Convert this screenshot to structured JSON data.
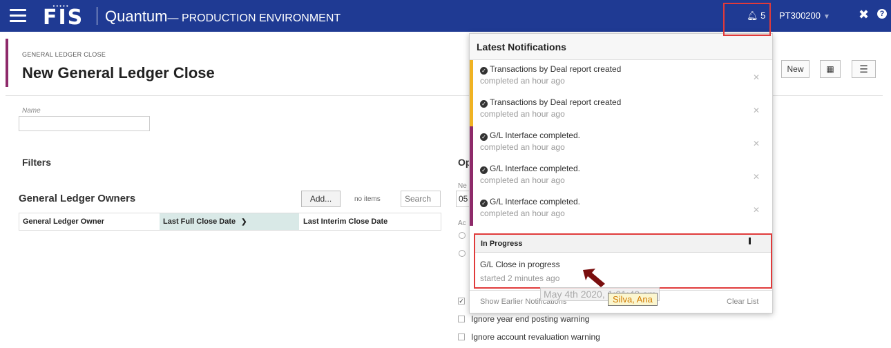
{
  "topbar": {
    "logo": "FIS",
    "app_name": "Quantum",
    "env": "— PRODUCTION ENVIRONMENT",
    "notification_count": "5",
    "user": "PT300200",
    "bell_icon": "bell-icon",
    "tools_icon": "tools-icon",
    "help_icon": "help-icon",
    "bar_color": "#1f3a93"
  },
  "header": {
    "breadcrumb": "GENERAL LEDGER CLOSE",
    "title": "New General Ledger Close",
    "new_label": "New"
  },
  "form": {
    "name_label": "Name",
    "name_value": "",
    "filters_title": "Filters",
    "owners_title": "General Ledger Owners",
    "add_label": "Add...",
    "no_items": "no items",
    "search_placeholder": "Search",
    "columns": [
      "General Ledger Owner",
      "Last Full Close Date",
      "Last Interim Close Date"
    ]
  },
  "options": {
    "title": "Op",
    "small_label_1": "Ne",
    "input_value": "05",
    "small_label_2": "Ac",
    "checkbox_1": "Ignore year end posting warning",
    "checkbox_2": "Ignore account revaluation warning"
  },
  "notifications": {
    "title": "Latest Notifications",
    "items": [
      {
        "text": "Transactions by Deal report created",
        "time": "completed an hour ago",
        "color": "#f0b323"
      },
      {
        "text": "Transactions by Deal report created",
        "time": "completed an hour ago",
        "color": "#f0b323"
      },
      {
        "text": "G/L Interface completed.",
        "time": "completed an hour ago",
        "color": "#8e2a6a"
      },
      {
        "text": "G/L Interface completed.",
        "time": "completed an hour ago",
        "color": "#8e2a6a"
      },
      {
        "text": "G/L Interface completed.",
        "time": "completed an hour ago",
        "color": "#8e2a6a"
      }
    ],
    "in_progress_title": "In Progress",
    "in_progress_text": "G/L Close in progress",
    "in_progress_time": "started 2 minutes ago",
    "show_earlier": "Show Earlier Notifications",
    "clear_list": "Clear List"
  },
  "overlay": {
    "date": "May 4th 2020, 1:01:49 am",
    "user": "Silva, Ana"
  }
}
